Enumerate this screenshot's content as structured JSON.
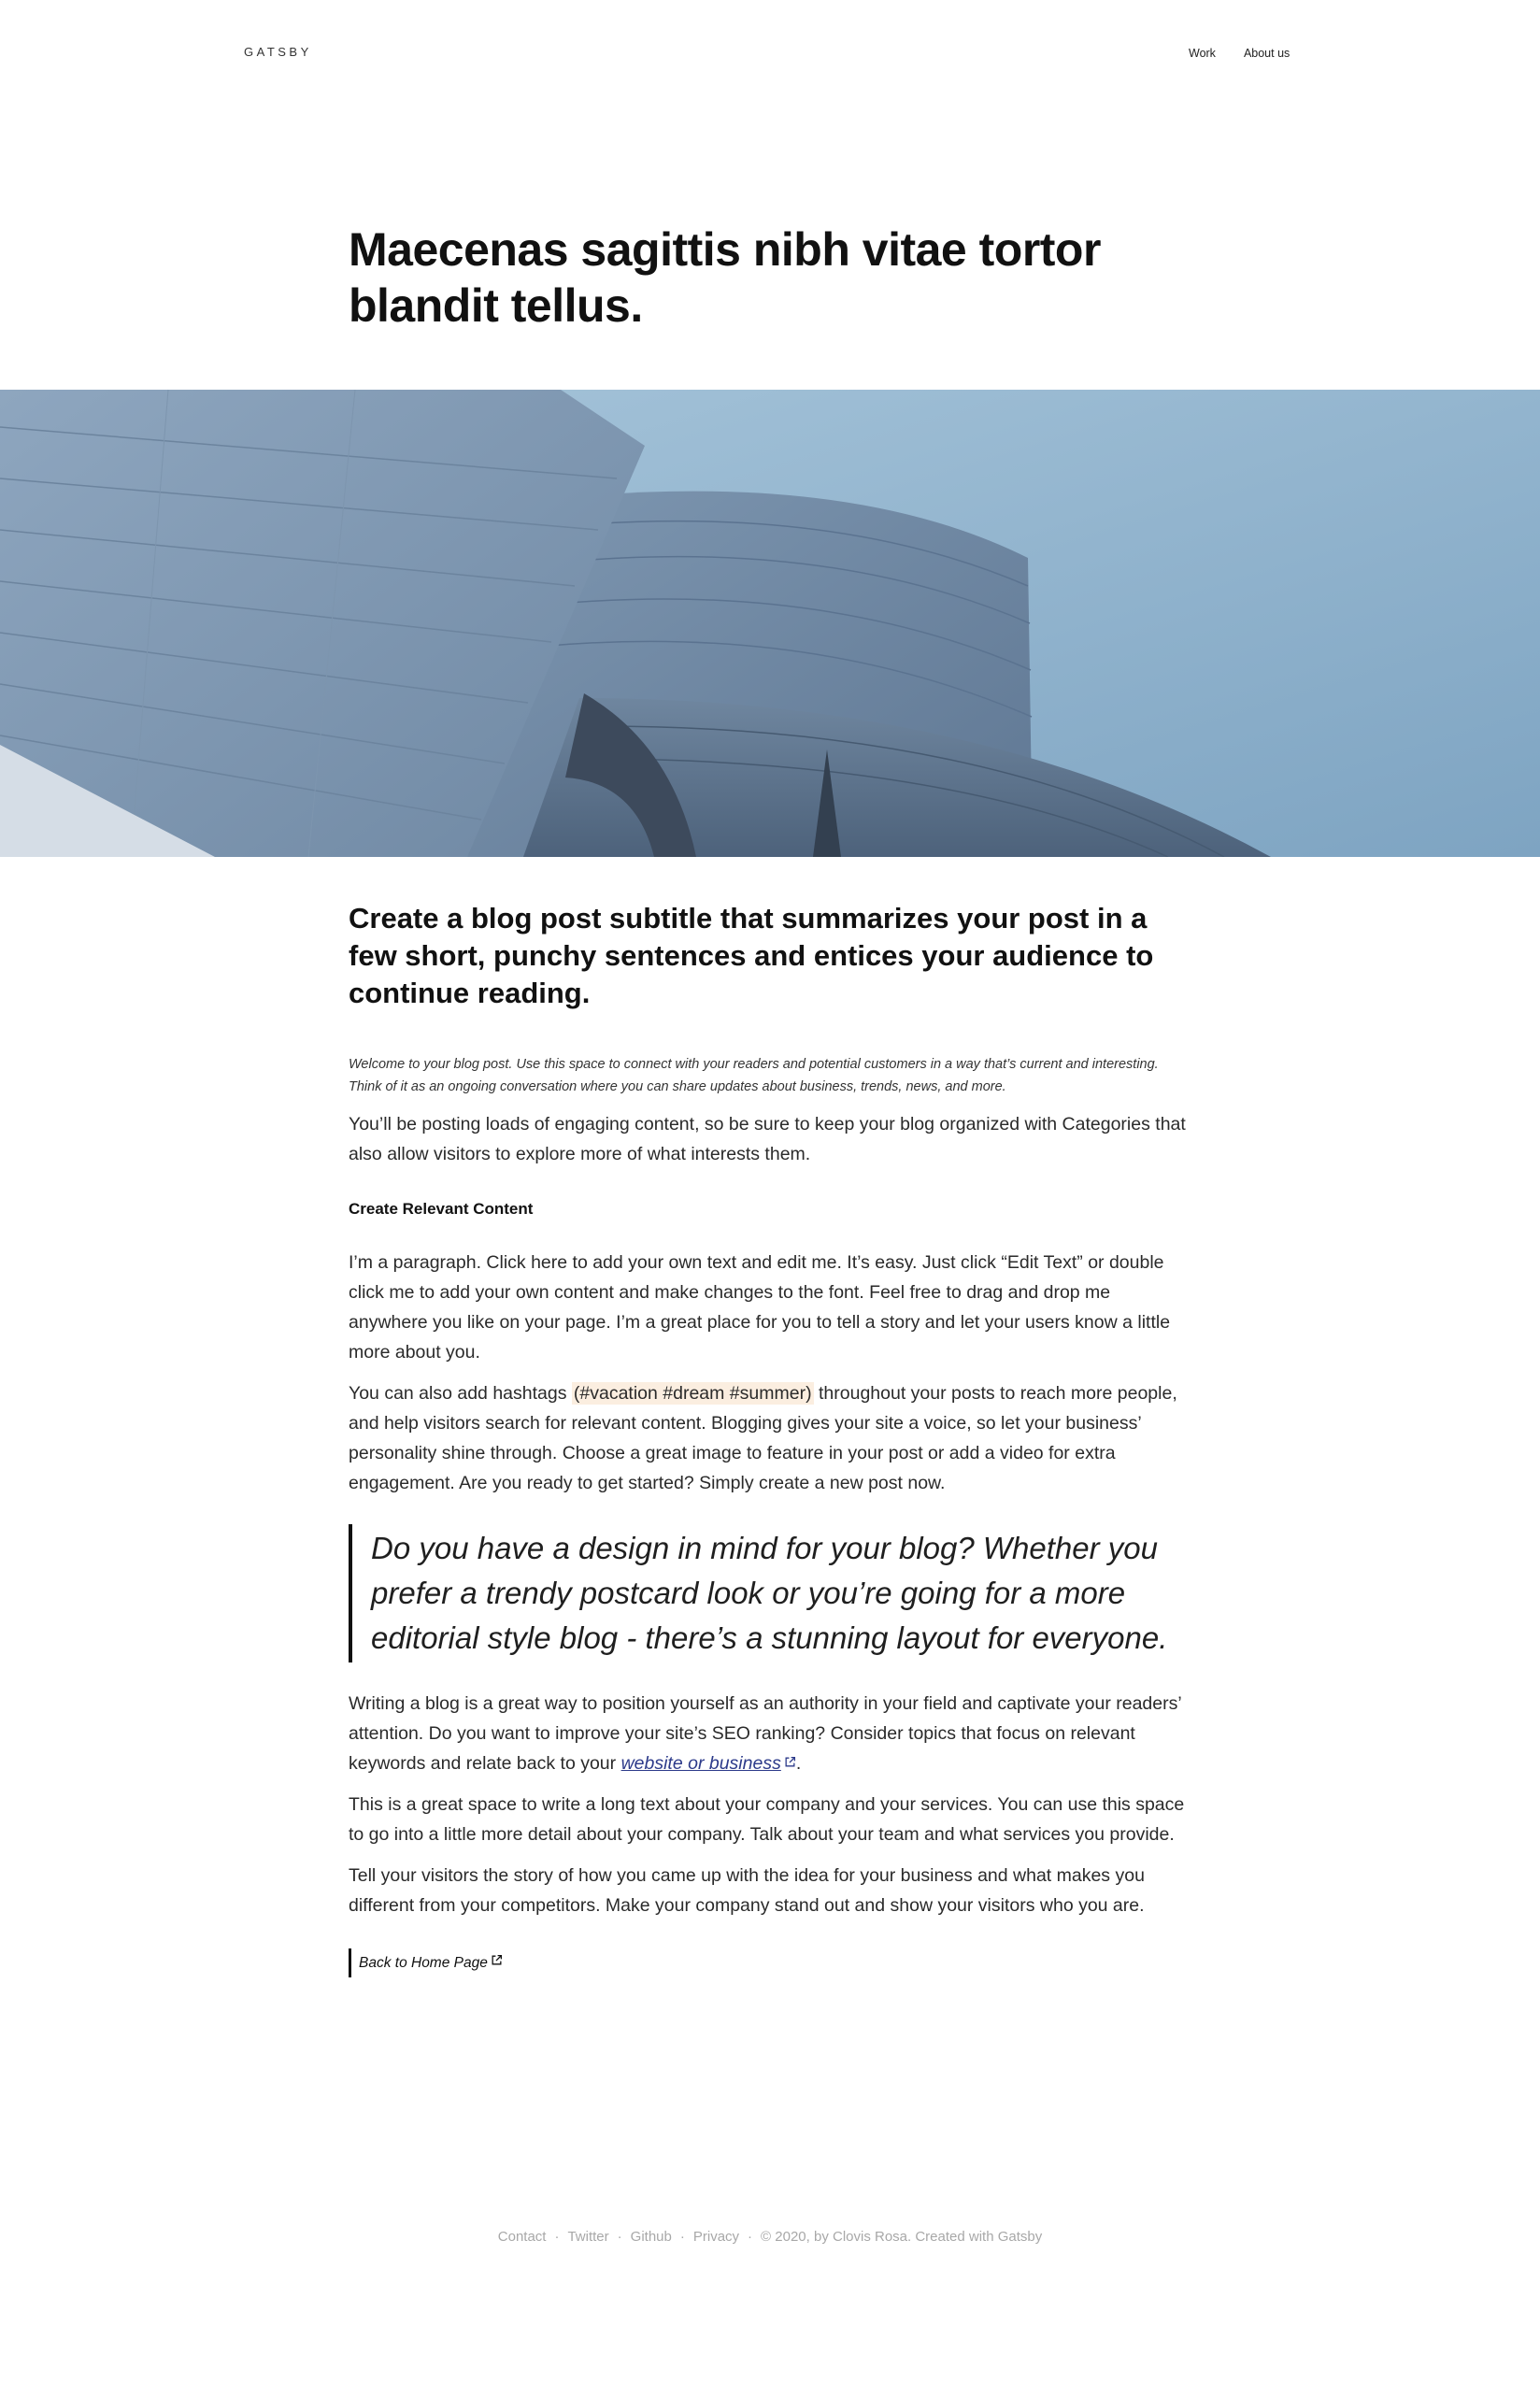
{
  "header": {
    "logo": "GATSBY",
    "nav": [
      {
        "label": "Work"
      },
      {
        "label": "About us"
      }
    ]
  },
  "post": {
    "title": "Maecenas sagittis nibh vitae tortor blandit tellus.",
    "hero_image": "architecture-metal-curves-sky",
    "subtitle": "Create a blog post subtitle that summarizes your post in a few short, punchy sentences and entices your audience to continue reading.",
    "intro": "Welcome to your blog post. Use this space to connect with your readers and potential customers in a way that’s current and interesting. Think of it as an ongoing conversation where you can share updates about business, trends, news, and more.",
    "para1": "You’ll be posting loads of engaging content, so be sure to keep your blog organized with Categories that also allow visitors to explore more of what interests them.",
    "section_heading": "Create Relevant Content",
    "para2": "I’m a paragraph. Click here to add your own text and edit me. It’s easy. Just click “Edit Text” or double click me to add your own content and make changes to the font. Feel free to drag and drop me anywhere you like on your page. I’m a great place for you to tell a story and let your users know a little more about you.",
    "para3_before": "You can also add hashtags ",
    "para3_hashtags": "(#vacation #dream #summer)",
    "para3_after": " throughout your posts to reach more people, and help visitors search for relevant content. Blogging gives your site a voice, so let your business’ personality shine through. Choose a great image to feature in your post or add a video for extra engagement. Are you ready to get started? Simply create a new post now.",
    "quote": "Do you have a design in mind for your blog? Whether you prefer a trendy postcard look or you’re going for a more editorial style blog - there’s a stunning layout for everyone.",
    "para4_before": "Writing a blog is a great way to position yourself as an authority in your field and captivate your readers’ attention. Do you want to improve your site’s SEO ranking? Consider topics that focus on relevant keywords and relate back to your ",
    "para4_link": "website or business",
    "para4_after": ".",
    "para5": "This is a great space to write a long text about your company and your services. You can use this space to go into a little more detail about your company. Talk about your team and what services you provide.",
    "para6": "Tell your visitors the story of how you came up with the idea for your business and what makes you different from your competitors. Make your company stand out and show your visitors who you are.",
    "back_link": "Back to Home Page"
  },
  "footer": {
    "links": [
      "Contact",
      "Twitter",
      "Github",
      "Privacy"
    ],
    "separator": "·",
    "copyright": "© 2020, by Clovis Rosa. Created with Gatsby"
  },
  "colors": {
    "text": "#1a1a1a",
    "link": "#2c3a8a",
    "hashtag_highlight": "#fbeee0",
    "footer_text": "#a8a8a8"
  }
}
